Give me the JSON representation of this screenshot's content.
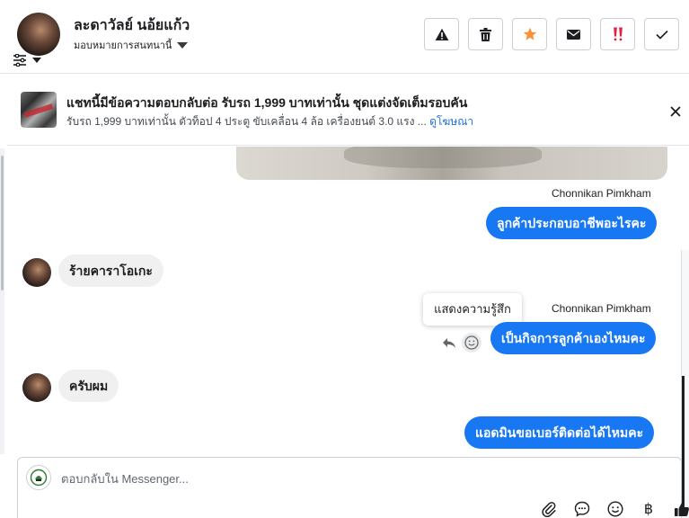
{
  "header": {
    "contact_name": "ละดาวัลย์ นอ้ยแก้ว",
    "assign_label": "มอบหมายการสนทนานี้",
    "actions": [
      {
        "name": "mark-spam",
        "icon": "warning-icon"
      },
      {
        "name": "delete",
        "icon": "trash-icon"
      },
      {
        "name": "star",
        "icon": "star-icon",
        "color": "#f7923b"
      },
      {
        "name": "mark-unread",
        "icon": "envelope-icon"
      },
      {
        "name": "follow-up",
        "icon": "double-exclamation-icon",
        "color": "#e41e3f"
      },
      {
        "name": "mark-done",
        "icon": "checkmark-icon"
      }
    ]
  },
  "ad": {
    "title": "แชทนี้มีข้อความตอบกลับต่อ รับรถ 1,999 บาทเท่านั้น ชุดแต่งจัดเต็มรอบคัน",
    "description": "รับรถ 1,999 บาทเท่านั้น ตัวท็อป 4 ประตู ขับเคลื่อน 4 ล้อ เครื่องยนต์ 3.0 แรง ...",
    "link": "ดูโฆษณา"
  },
  "messages": {
    "sender1": "Chonnikan Pimkham",
    "out1": "ลูกค้าประกอบอาชีพอะไรคะ",
    "in1": "ร้ายคาราโอเกะ",
    "tooltip": "แสดงความรู้สึก",
    "sender2": "Chonnikan Pimkham",
    "out2": "เป็นกิจการลูกค้าเองไหมคะ",
    "in2": "ครับผม",
    "out3": "แอดมินขอเบอร์ติดต่อได้ไหมคะ"
  },
  "composer": {
    "placeholder": "ตอบกลับใน Messenger...",
    "currency_symbol": "฿"
  },
  "colors": {
    "accent": "#1877f2",
    "incoming_bubble": "#f0f0f0",
    "link": "#216fdb"
  }
}
